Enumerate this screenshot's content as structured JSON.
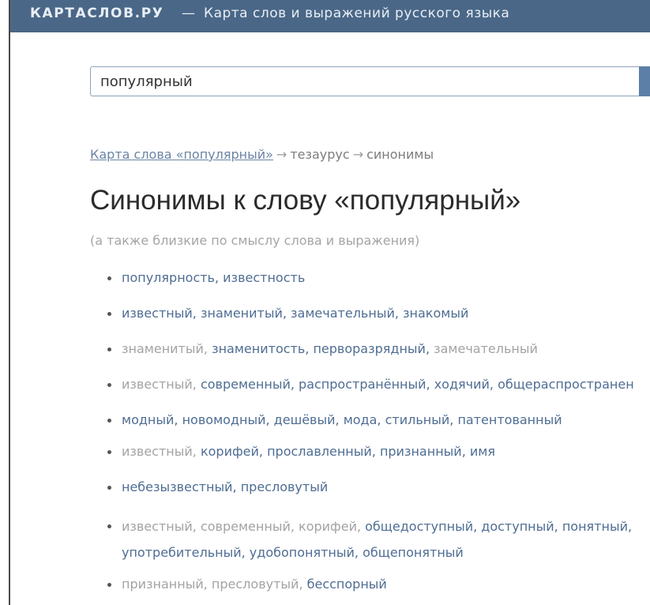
{
  "header": {
    "brand": "КАРТАСЛОВ.РУ",
    "separator": "—",
    "tagline": "Карта слов и выражений русского языка"
  },
  "search": {
    "value": "популярный"
  },
  "breadcrumb": {
    "link": "Карта слова «популярный»",
    "arrow1": "→",
    "item2": "тезаурус",
    "arrow2": "→",
    "item3": "синонимы"
  },
  "page": {
    "title": "Синонимы к слову «популярный»",
    "subtitle": "(а также близкие по смыслу слова и выражения)"
  },
  "synonym_groups": [
    [
      {
        "text": "популярность",
        "style": "strong"
      },
      {
        "text": "известность",
        "style": "strong"
      }
    ],
    [
      {
        "text": "известный",
        "style": "strong"
      },
      {
        "text": "знаменитый",
        "style": "strong"
      },
      {
        "text": "замечательный",
        "style": "strong"
      },
      {
        "text": "знакомый",
        "style": "strong"
      }
    ],
    [
      {
        "text": "знаменитый",
        "style": "weak"
      },
      {
        "text": "знаменитость",
        "style": "strong"
      },
      {
        "text": "перворазрядный",
        "style": "strong"
      },
      {
        "text": "замечательный",
        "style": "weak"
      }
    ],
    [
      {
        "text": "известный",
        "style": "weak"
      },
      {
        "text": "современный",
        "style": "strong"
      },
      {
        "text": "распространённый",
        "style": "strong"
      },
      {
        "text": "ходячий",
        "style": "strong"
      },
      {
        "text": "общераспространен",
        "style": "strong"
      }
    ],
    [
      {
        "text": "модный",
        "style": "strong"
      },
      {
        "text": "новомодный",
        "style": "strong"
      },
      {
        "text": "дешёвый",
        "style": "strong"
      },
      {
        "text": "мода",
        "style": "strong"
      },
      {
        "text": "стильный",
        "style": "strong"
      },
      {
        "text": "патентованный",
        "style": "strong"
      }
    ],
    [
      {
        "text": "известный",
        "style": "weak"
      },
      {
        "text": "корифей",
        "style": "strong"
      },
      {
        "text": "прославленный",
        "style": "strong"
      },
      {
        "text": "признанный",
        "style": "strong"
      },
      {
        "text": "имя",
        "style": "strong"
      }
    ],
    [
      {
        "text": "небезызвестный",
        "style": "strong"
      },
      {
        "text": "пресловутый",
        "style": "strong"
      }
    ],
    [
      {
        "text": "известный",
        "style": "weak"
      },
      {
        "text": "современный",
        "style": "weak"
      },
      {
        "text": "корифей",
        "style": "weak"
      },
      {
        "text": "общедоступный",
        "style": "strong"
      },
      {
        "text": "доступный",
        "style": "strong"
      },
      {
        "text": "понятный",
        "style": "strong"
      },
      {
        "text": "употребительный",
        "style": "strong"
      },
      {
        "text": "удобопонятный",
        "style": "strong"
      },
      {
        "text": "общепонятный",
        "style": "strong"
      }
    ],
    [
      {
        "text": "признанный",
        "style": "weak"
      },
      {
        "text": "пресловутый",
        "style": "weak"
      },
      {
        "text": "бесспорный",
        "style": "strong"
      }
    ]
  ],
  "colors": {
    "header_bg": "#4a6787",
    "link_strong": "#4f6d93",
    "link_weak": "#a3a3a3",
    "search_button": "#5b7fa6"
  }
}
